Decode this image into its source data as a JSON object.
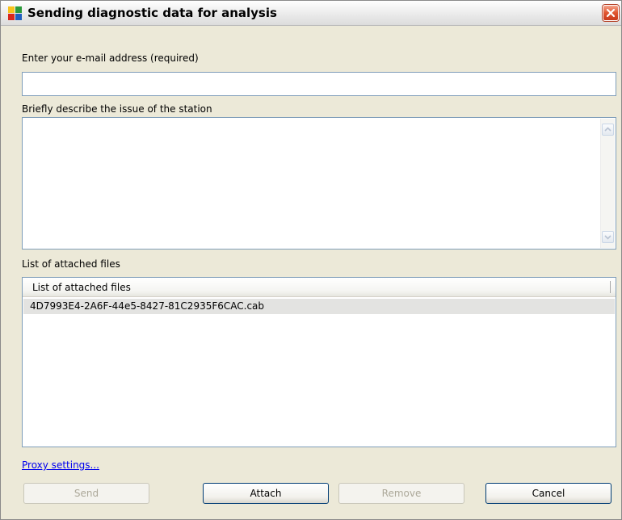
{
  "window": {
    "title": "Sending diagnostic data for analysis"
  },
  "email": {
    "label": "Enter your e-mail address (required)",
    "value": ""
  },
  "description": {
    "label": "Briefly describe the issue of the station",
    "value": ""
  },
  "attachments": {
    "label": "List of attached files",
    "column_header": "List of attached files",
    "files": [
      "4D7993E4-2A6F-44e5-8427-81C2935F6CAC.cab"
    ]
  },
  "proxy_link": "Proxy settings...",
  "buttons": {
    "send": "Send",
    "attach": "Attach",
    "remove": "Remove",
    "cancel": "Cancel"
  }
}
